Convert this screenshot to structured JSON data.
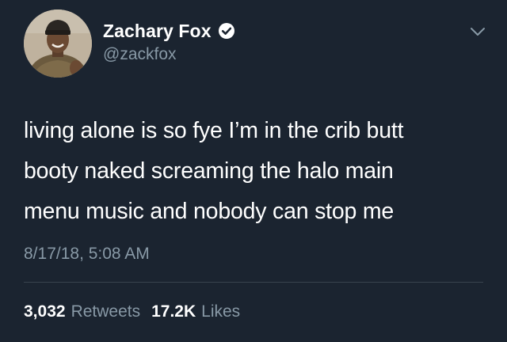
{
  "profile": {
    "display_name": "Zachary Fox",
    "handle": "@zackfox",
    "verified": true
  },
  "tweet": {
    "text": "living alone is so fye I’m in the crib butt\nbooty naked screaming the halo main\nmenu music and nobody can stop me",
    "timestamp": "8/17/18, 5:08 AM"
  },
  "stats": {
    "retweets_count": "3,032",
    "retweets_label": "Retweets",
    "likes_count": "17.2K",
    "likes_label": "Likes"
  },
  "icons": {
    "verified": "verified-badge-icon",
    "menu": "chevron-down-icon"
  },
  "colors": {
    "background": "#1b2430",
    "secondary_text": "#8899a6",
    "primary_text": "#ffffff"
  }
}
